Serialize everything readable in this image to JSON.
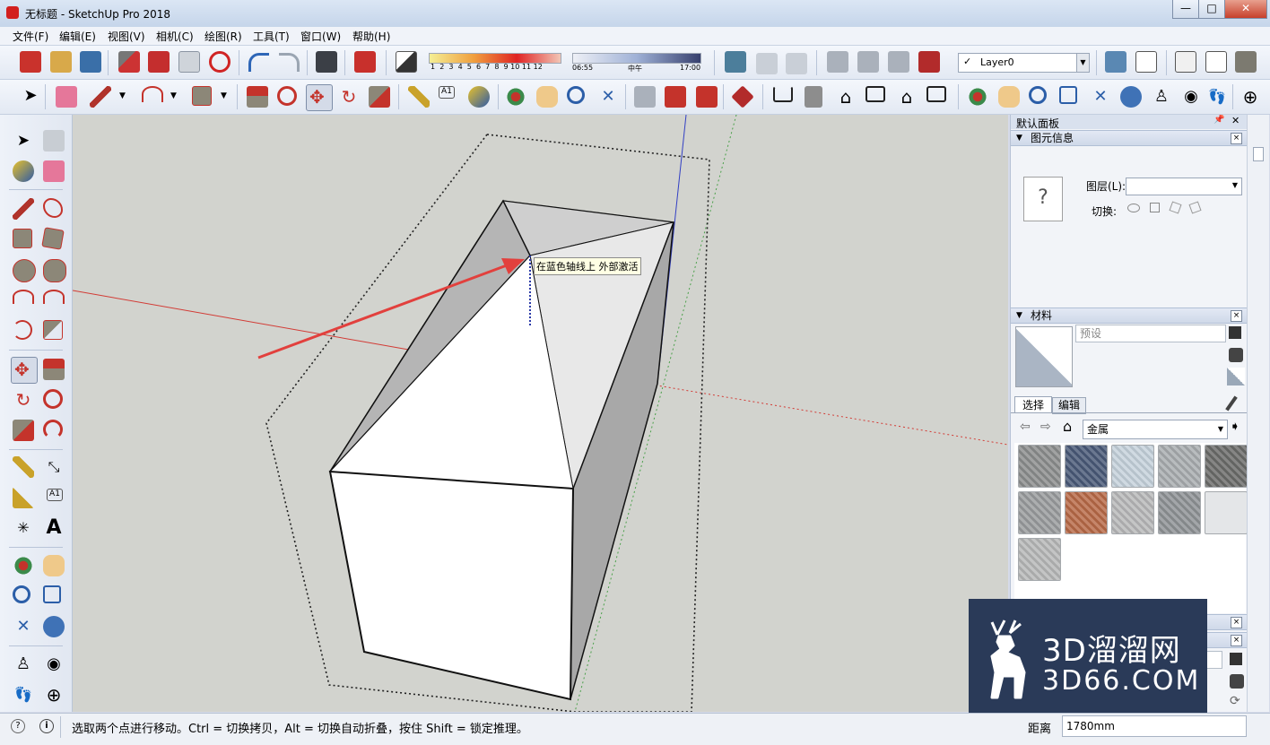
{
  "window": {
    "title": "无标题 - SketchUp Pro 2018",
    "minimize": "—",
    "maximize": "□",
    "close": "✕"
  },
  "menu": [
    "文件(F)",
    "编辑(E)",
    "视图(V)",
    "相机(C)",
    "绘图(R)",
    "工具(T)",
    "窗口(W)",
    "帮助(H)"
  ],
  "shadow": {
    "months": [
      "1",
      "2",
      "3",
      "4",
      "5",
      "6",
      "7",
      "8",
      "9",
      "10",
      "11",
      "12"
    ],
    "time_start": "06:55",
    "time_mid": "中午",
    "time_end": "17:00"
  },
  "layer": {
    "checked_glyph": "✓",
    "current": "Layer0"
  },
  "viewport": {
    "tooltip": "在蓝色轴线上 外部激活"
  },
  "panel": {
    "title": "默认面板",
    "pin_glyph": "📌",
    "close_glyph": "✕",
    "entity_info": {
      "title": "图元信息",
      "icon_text": "?",
      "layer_label": "图层(L):",
      "toggle_label": "切换:"
    },
    "materials": {
      "title": "材料",
      "preset_placeholder": "预设",
      "tab_select": "选择",
      "tab_edit": "编辑",
      "category": "金属",
      "swatch_colors": [
        "#8c8e8e",
        "#4a5a78",
        "#c6d2dc",
        "#a9adb0",
        "#6b6c6a",
        "#9a9c9e",
        "#b86a48",
        "#b8b9ba",
        "#8f9396",
        "#e4e6e8",
        "#b7b8b8"
      ]
    },
    "measure_label": "距离",
    "measure_value": "1780mm"
  },
  "status": {
    "text": "选取两个点进行移动。Ctrl = 切换拷贝，Alt = 切换自动折叠，按住 Shift = 锁定推理。"
  },
  "watermark": {
    "logo_text": "3D溜溜网",
    "url_text": "3D66.COM"
  }
}
